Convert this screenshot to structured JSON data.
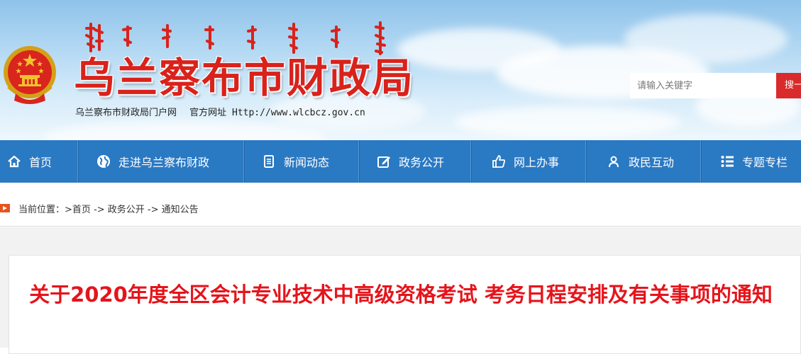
{
  "header": {
    "site_title": "乌兰察布市财政局",
    "portal_name": "乌兰察布市财政局门户网",
    "url_label": "官方网址",
    "url": "Http://www.wlcbcz.gov.cn",
    "search_placeholder": "请输入关键字",
    "search_button": "搜一"
  },
  "nav": {
    "items": [
      {
        "label": "首页",
        "icon": "home-icon"
      },
      {
        "label": "走进乌兰察布财政",
        "icon": "globe-icon"
      },
      {
        "label": "新闻动态",
        "icon": "document-icon"
      },
      {
        "label": "政务公开",
        "icon": "edit-icon"
      },
      {
        "label": "网上办事",
        "icon": "thumbs-up-icon"
      },
      {
        "label": "政民互动",
        "icon": "user-icon"
      },
      {
        "label": "专题专栏",
        "icon": "list-icon"
      }
    ]
  },
  "breadcrumb": {
    "prefix": "当前位置：",
    "items": [
      ">首页",
      " -> 政务公开",
      " -> 通知公告"
    ]
  },
  "article": {
    "title": "关于2020年度全区会计专业技术中高级资格考试 考务日程安排及有关事项的通知"
  },
  "colors": {
    "nav_blue": "#2a79c3",
    "title_red": "#e5141b",
    "search_red": "#d92b2b"
  }
}
